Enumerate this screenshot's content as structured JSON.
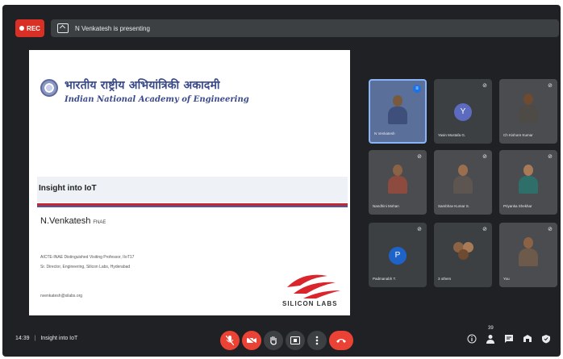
{
  "topbar": {
    "rec_label": "REC",
    "presenter_text": "N Venkatesh is presenting"
  },
  "slide": {
    "hindi_title": "भारतीय राष्ट्रीय अभियांत्रिकी अकादमी",
    "english_title": "Indian National Academy of Engineering",
    "talk_title": "Insight into IoT",
    "speaker_name": "N.Venkatesh",
    "speaker_suffix": "FNAE",
    "affiliation_1": "AICTE-INAE Distinguished Visiting Professor, IIoT17",
    "affiliation_2": "Sr. Director, Engineering, Silicon Labs, Hyderabad",
    "contact": "nvenkatesh@silabs.org",
    "sponsor_logo_text": "SILICON LABS"
  },
  "participants": [
    {
      "name": "N Venkatesh",
      "kind": "video",
      "speaking": true,
      "skin": "#7a5a3c",
      "shirt": "#3d4f7a"
    },
    {
      "name": "Yasin Mustafa G.",
      "kind": "avatar",
      "letter": "Y",
      "color": "#5c6bc0"
    },
    {
      "name": "Ch Kishore Kumar",
      "kind": "video",
      "skin": "#6d4a30",
      "shirt": "#4e4a45"
    },
    {
      "name": "Nandhini Mohan",
      "kind": "video",
      "skin": "#8c6244",
      "shirt": "#8d4a3e"
    },
    {
      "name": "Sambhav Kumar S.",
      "kind": "video",
      "skin": "#9b6f4e",
      "shirt": "#5d5550"
    },
    {
      "name": "Priyanka Shekhar",
      "kind": "video",
      "skin": "#a87a58",
      "shirt": "#2f6f6a"
    },
    {
      "name": "Padmanabh T.",
      "kind": "avatar",
      "letter": "P",
      "color": "#1e63c8"
    },
    {
      "name": "3 others",
      "kind": "group"
    },
    {
      "name": "You",
      "kind": "video",
      "skin": "#8c6244",
      "shirt": "#6d5a4a"
    }
  ],
  "bottombar": {
    "time": "14:39",
    "meeting_title": "Insight into IoT",
    "people_count": "39"
  },
  "colors": {
    "background": "#202124",
    "tile": "#3c4043",
    "danger": "#ea4335",
    "accent": "#8ab4f8"
  },
  "icons": [
    "mic-off-icon",
    "camera-off-icon",
    "raise-hand-icon",
    "present-icon",
    "more-options-icon",
    "end-call-icon",
    "info-icon",
    "people-icon",
    "chat-icon",
    "activities-icon",
    "host-controls-icon"
  ]
}
